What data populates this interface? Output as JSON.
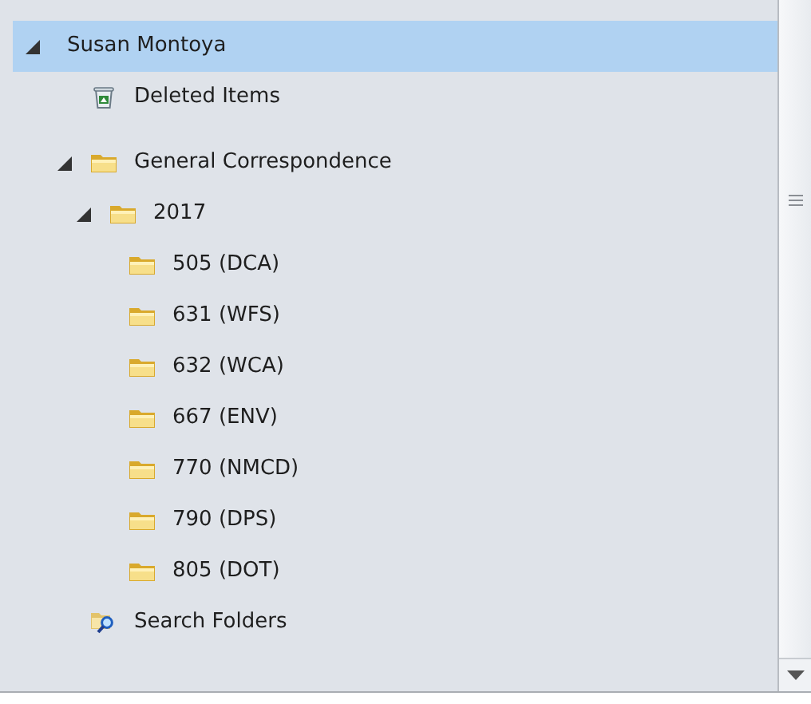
{
  "tree": [
    {
      "label": "Susan Montoya",
      "kind": "account",
      "expanded": true,
      "selected": true,
      "children": [
        {
          "label": "Deleted Items",
          "kind": "trash",
          "selected": false
        },
        {
          "label": "General Correspondence",
          "kind": "folder",
          "expanded": true,
          "selected": false,
          "children": [
            {
              "label": "2017",
              "kind": "folder",
              "expanded": true,
              "selected": false,
              "children": [
                {
                  "label": "505 (DCA)",
                  "kind": "folder",
                  "selected": false
                },
                {
                  "label": "631 (WFS)",
                  "kind": "folder",
                  "selected": false
                },
                {
                  "label": "632 (WCA)",
                  "kind": "folder",
                  "selected": false
                },
                {
                  "label": "667 (ENV)",
                  "kind": "folder",
                  "selected": false
                },
                {
                  "label": "770 (NMCD)",
                  "kind": "folder",
                  "selected": false
                },
                {
                  "label": "790 (DPS)",
                  "kind": "folder",
                  "selected": false
                },
                {
                  "label": "805 (DOT)",
                  "kind": "folder",
                  "selected": false
                }
              ]
            }
          ]
        },
        {
          "label": "Search Folders",
          "kind": "search",
          "selected": false
        }
      ]
    }
  ]
}
